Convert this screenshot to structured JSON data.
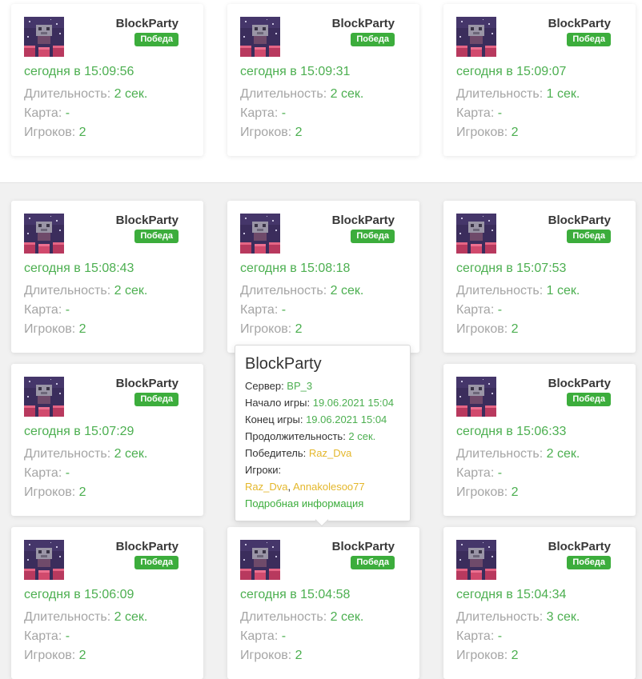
{
  "cards": [
    {
      "game": "BlockParty",
      "result": "Победа",
      "time": "сегодня в 15:09:56",
      "duration_label": "Длительность: ",
      "duration": "2 сек.",
      "map_label": "Карта: ",
      "map": "-",
      "players_label": "Игроков: ",
      "players": "2"
    },
    {
      "game": "BlockParty",
      "result": "Победа",
      "time": "сегодня в 15:09:31",
      "duration_label": "Длительность: ",
      "duration": "2 сек.",
      "map_label": "Карта: ",
      "map": "-",
      "players_label": "Игроков: ",
      "players": "2"
    },
    {
      "game": "BlockParty",
      "result": "Победа",
      "time": "сегодня в 15:09:07",
      "duration_label": "Длительность: ",
      "duration": "1 сек.",
      "map_label": "Карта: ",
      "map": "-",
      "players_label": "Игроков: ",
      "players": "2"
    },
    {
      "game": "BlockParty",
      "result": "Победа",
      "time": "сегодня в 15:08:43",
      "duration_label": "Длительность: ",
      "duration": "2 сек.",
      "map_label": "Карта: ",
      "map": "-",
      "players_label": "Игроков: ",
      "players": "2"
    },
    {
      "game": "BlockParty",
      "result": "Победа",
      "time": "сегодня в 15:08:18",
      "duration_label": "Длительность: ",
      "duration": "2 сек.",
      "map_label": "Карта: ",
      "map": "-",
      "players_label": "Игроков: ",
      "players": "2"
    },
    {
      "game": "BlockParty",
      "result": "Победа",
      "time": "сегодня в 15:07:53",
      "duration_label": "Длительность: ",
      "duration": "1 сек.",
      "map_label": "Карта: ",
      "map": "-",
      "players_label": "Игроков: ",
      "players": "2"
    },
    {
      "game": "BlockParty",
      "result": "Победа",
      "time": "сегодня в 15:07:29",
      "duration_label": "Длительность: ",
      "duration": "2 сек.",
      "map_label": "Карта: ",
      "map": "-",
      "players_label": "Игроков: ",
      "players": "2"
    },
    {
      "game": "BlockParty",
      "result": "Победа",
      "time": "сегодня в 15:06:33",
      "duration_label": "Длительность: ",
      "duration": "2 сек.",
      "map_label": "Карта: ",
      "map": "-",
      "players_label": "Игроков: ",
      "players": "2"
    },
    {
      "game": "BlockParty",
      "result": "Победа",
      "time": "сегодня в 15:06:09",
      "duration_label": "Длительность: ",
      "duration": "2 сек.",
      "map_label": "Карта: ",
      "map": "-",
      "players_label": "Игроков: ",
      "players": "2"
    },
    {
      "game": "BlockParty",
      "result": "Победа",
      "time": "сегодня в 15:04:58",
      "duration_label": "Длительность: ",
      "duration": "2 сек.",
      "map_label": "Карта: ",
      "map": "-",
      "players_label": "Игроков: ",
      "players": "2"
    },
    {
      "game": "BlockParty",
      "result": "Победа",
      "time": "сегодня в 15:04:34",
      "duration_label": "Длительность: ",
      "duration": "3 сек.",
      "map_label": "Карта: ",
      "map": "-",
      "players_label": "Игроков: ",
      "players": "2"
    }
  ],
  "tooltip": {
    "title": "BlockParty",
    "server_label": "Сервер: ",
    "server": "BP_3",
    "start_label": "Начало игры: ",
    "start": "19.06.2021 15:04",
    "end_label": "Конец игры: ",
    "end": "19.06.2021 15:04",
    "duration_label": "Продолжительность: ",
    "duration": "2 сек.",
    "winner_label": "Победитель: ",
    "winner": "Raz_Dva",
    "players_label": "Игроки:",
    "players": [
      "Raz_Dva",
      "Annakolesoo77"
    ],
    "players_sep": ", ",
    "details_link": "Подробная информация"
  },
  "icons": {
    "thumbnail": "blockparty-thumbnail-icon"
  },
  "colors": {
    "accent": "#4caf50",
    "badge": "#3cad3c",
    "highlight": "#e4b72b",
    "muted": "#a5a5a5"
  }
}
